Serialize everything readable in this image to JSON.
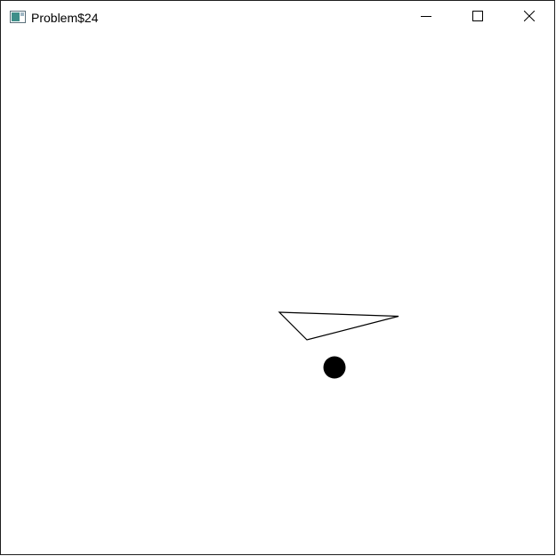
{
  "window": {
    "title": "Problem$24",
    "buttons": {
      "minimize_icon": "minimize-icon",
      "maximize_icon": "maximize-icon",
      "close_icon": "close-icon"
    }
  },
  "canvas": {
    "background": "#ffffff",
    "stroke_color": "#000000",
    "fill_color": "#000000",
    "shapes": [
      "triangle-outline",
      "filled-circle"
    ]
  }
}
